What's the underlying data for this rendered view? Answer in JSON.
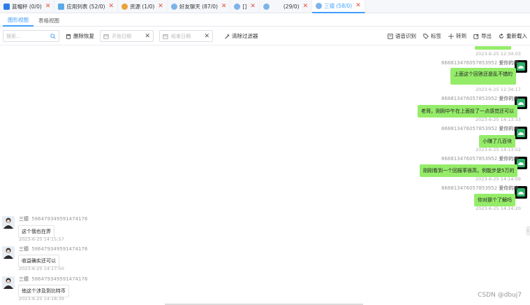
{
  "tabs": [
    {
      "label": "蓝帽杯 (0/0)",
      "color": "#2b7de9"
    },
    {
      "label": "应用列表 (52/0)",
      "color": "#5aa9e6"
    },
    {
      "label": "资源 (1/0)",
      "color": "#e9a23b"
    },
    {
      "label": "好友聊天 (87/0)",
      "color": "#7fb3e8"
    },
    {
      "label": "[]",
      "color": "#7fb3e8"
    },
    {
      "label": "(29/0)",
      "color": "#7fb3e8"
    },
    {
      "label": "三德 (58/0)",
      "color": "#7fb3e8"
    }
  ],
  "view_tabs": {
    "graphic": "图形视图",
    "table": "表格视图"
  },
  "toolbar": {
    "search_placeholder": "搜索...",
    "delete_restore": "删除恢复",
    "start_date": "开始日期",
    "end_date": "结束日期",
    "clear_filter": "清除过滤器",
    "speech": "语音识别",
    "tag": "标签",
    "goto": "转到",
    "export": "导出",
    "reload": "重新载入"
  },
  "messages_right": [
    {
      "time": "2023-6-25 12:34:03"
    },
    {
      "id": "868813476057853952",
      "name": "爱你的病",
      "text": "上面这个回答还是乱不错的",
      "time": "2023-6-25 12:34:17"
    },
    {
      "id": "868813476057853952",
      "name": "爱你的病",
      "text": "老哥，刚刚中午在上面投了一点感觉还可以",
      "time": "2023-6-25 14:13:33"
    },
    {
      "id": "868813476057853952",
      "name": "爱你的病",
      "text": "小赚了几百块",
      "time": "2023-6-25 14:13:52"
    },
    {
      "id": "868813476057853952",
      "name": "爱你的病",
      "text": "刚刚看到一个回报率很高，例能步是5万的",
      "time": "2023-6-25 14:14:09"
    },
    {
      "id": "868813476057853952",
      "name": "爱你的病",
      "text": "你对那个了解吗",
      "time": "2023-6-25 14:14:20"
    }
  ],
  "messages_left": [
    {
      "name": "三德",
      "id": "586479349591474176",
      "text": "这个我也在弄",
      "time": "2023-6-25 14:15:57"
    },
    {
      "name": "三德",
      "id": "586479349591474176",
      "text": "收益确实还可以",
      "time": "2023-6-25 14:17:50"
    },
    {
      "name": "三德",
      "id": "586479349591474176",
      "text": "他这个涉及到比特币",
      "time": "2023-6-25 14:18:39"
    }
  ],
  "watermark": "CSDN @dbuj7",
  "colors": {
    "accent": "#409eff",
    "bubble": "#95ec69",
    "close": "#e74c3c"
  }
}
